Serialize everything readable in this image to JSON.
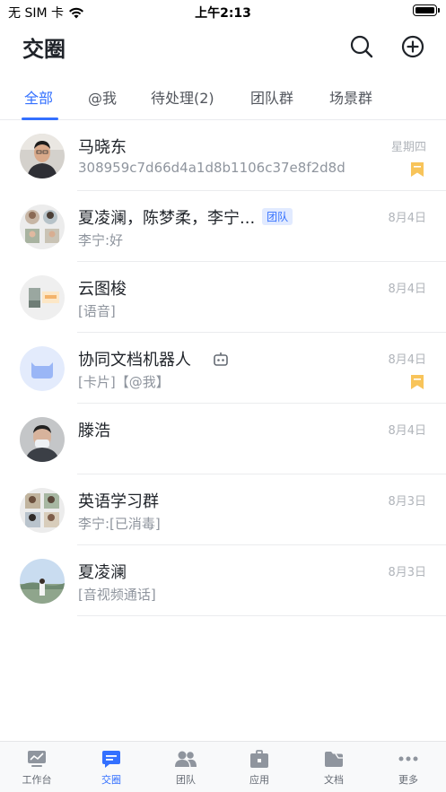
{
  "status_bar": {
    "carrier": "无 SIM 卡",
    "time": "上午2:13"
  },
  "header": {
    "title": "交圈"
  },
  "tabs": [
    {
      "label": "全部"
    },
    {
      "label": "@我"
    },
    {
      "label": "待处理(2)"
    },
    {
      "label": "团队群"
    },
    {
      "label": "场景群"
    }
  ],
  "chats": [
    {
      "name": "马晓东",
      "preview": "308959c7d66d4a1d8b1106c37e8f2d8d",
      "time": "星期四",
      "flagged": true
    },
    {
      "name": "夏凌澜，陈梦柔，李宁...",
      "tag": "团队",
      "preview": "李宁:好",
      "time": "8月4日",
      "flagged": false
    },
    {
      "name": "云图梭",
      "preview": "[语音]",
      "time": "8月4日",
      "flagged": false
    },
    {
      "name": "协同文档机器人",
      "preview": "[卡片]【@我】",
      "time": "8月4日",
      "flagged": true
    },
    {
      "name": "滕浩",
      "preview": "",
      "time": "8月4日",
      "flagged": false
    },
    {
      "name": "英语学习群",
      "preview": "李宁:[已消毒]",
      "time": "8月3日",
      "flagged": false
    },
    {
      "name": "夏凌澜",
      "preview": "[音视频通话]",
      "time": "8月3日",
      "flagged": false
    }
  ],
  "tabbar": [
    {
      "label": "工作台",
      "icon": "workbench-icon"
    },
    {
      "label": "交圈",
      "icon": "chat-bubble-icon"
    },
    {
      "label": "团队",
      "icon": "team-icon"
    },
    {
      "label": "应用",
      "icon": "apps-briefcase-icon"
    },
    {
      "label": "文档",
      "icon": "folder-icon"
    },
    {
      "label": "更多",
      "icon": "more-dots-icon"
    }
  ],
  "colors": {
    "accent": "#3370ff",
    "flag": "#f8c45a",
    "text_secondary": "#8f959e"
  }
}
